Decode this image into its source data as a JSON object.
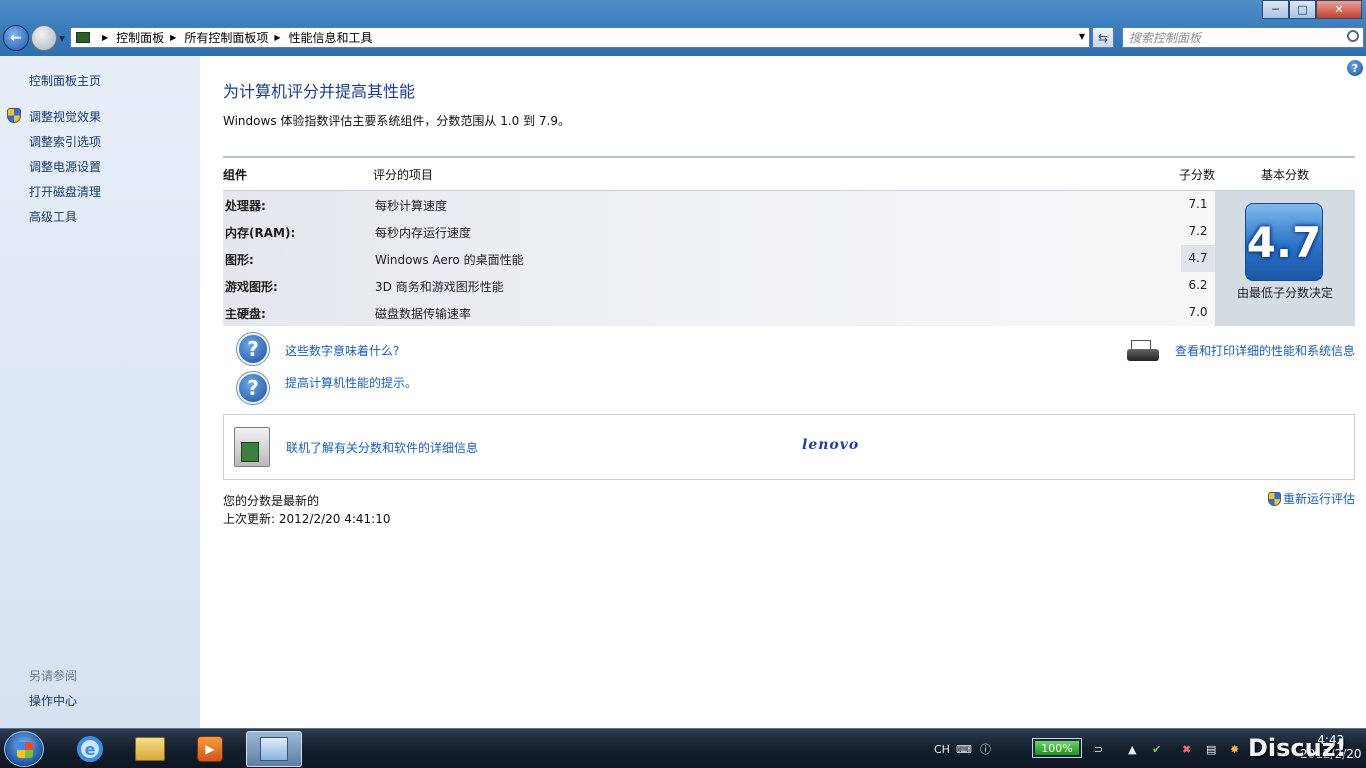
{
  "titlebar": {
    "minimize_label": "─",
    "maximize_label": "□",
    "close_label": "✕",
    "back_label": "←"
  },
  "address": {
    "crumbs": [
      "控制面板",
      "所有控制面板项",
      "性能信息和工具"
    ],
    "refresh_icon": "refresh-icon"
  },
  "search": {
    "placeholder": "搜索控制面板"
  },
  "sidebar": {
    "home": "控制面板主页",
    "items": [
      {
        "label": "调整视觉效果",
        "icon": "shield-icon"
      },
      {
        "label": "调整索引选项"
      },
      {
        "label": "调整电源设置"
      },
      {
        "label": "打开磁盘清理"
      },
      {
        "label": "高级工具"
      }
    ],
    "see_also": "另请参阅",
    "action_center": "操作中心"
  },
  "main": {
    "help_label": "?",
    "title": "为计算机评分并提高其性能",
    "description": "Windows 体验指数评估主要系统组件，分数范围从 1.0 到 7.9。",
    "table": {
      "headers": {
        "component": "组件",
        "rated": "评分的项目",
        "subscore": "子分数",
        "basescore": "基本分数"
      },
      "rows": [
        {
          "component": "处理器:",
          "item": "每秒计算速度",
          "score": "7.1"
        },
        {
          "component": "内存(RAM):",
          "item": "每秒内存运行速度",
          "score": "7.2"
        },
        {
          "component": "图形:",
          "item": "Windows Aero 的桌面性能",
          "score": "4.7"
        },
        {
          "component": "游戏图形:",
          "item": "3D 商务和游戏图形性能",
          "score": "6.2"
        },
        {
          "component": "主硬盘:",
          "item": "磁盘数据传输速率",
          "score": "7.0"
        }
      ],
      "base_score": "4.7",
      "base_caption": "由最低子分数决定"
    },
    "links": {
      "what_mean": "这些数字意味着什么?",
      "tips": "提高计算机性能的提示。",
      "print": "查看和打印详细的性能和系统信息",
      "question_icon_label": "?"
    },
    "online": {
      "link": "联机了解有关分数和软件的详细信息",
      "brand": "lenovo"
    },
    "status": {
      "current": "您的分数是最新的",
      "last_update": "上次更新: 2012/2/20 4:41:10",
      "rerun": "重新运行评估"
    }
  },
  "taskbar": {
    "ie_glyph": "e",
    "media_glyph": "▶",
    "language": "CH",
    "battery": "100%",
    "time": "4:42",
    "date": "2012/2/20",
    "watermark": "Discuz!"
  },
  "colors": {
    "link": "#1f5db4",
    "title": "#1a3e8c",
    "accent": "#2a73c9"
  }
}
